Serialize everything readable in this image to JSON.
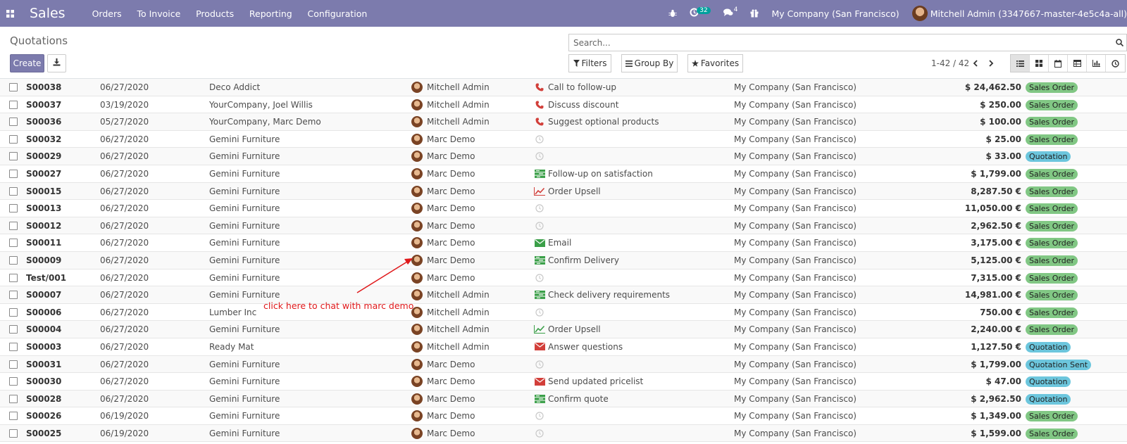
{
  "navbar": {
    "brand": "Sales",
    "menu": [
      "Orders",
      "To Invoice",
      "Products",
      "Reporting",
      "Configuration"
    ],
    "activity_count": "32",
    "message_count": "4",
    "company": "My Company (San Francisco)",
    "user": "Mitchell Admin (3347667-master-4e5c4a-all)"
  },
  "control_panel": {
    "title": "Quotations",
    "create_label": "Create",
    "search_placeholder": "Search...",
    "filters_label": "Filters",
    "groupby_label": "Group By",
    "favorites_label": "Favorites",
    "pager": "1-42 / 42"
  },
  "annotation": "click here to chat with marc demo",
  "colors": {
    "navbar": "#7c7bad",
    "sales_order": "#81c784",
    "quotation": "#6cc6dd",
    "annotation": "#e0191b"
  },
  "rows": [
    {
      "num": "S00038",
      "date": "06/27/2020",
      "customer": "Deco Addict",
      "salesperson": "Mitchell Admin",
      "activity_icon": "phone-icon",
      "activity": "Call to follow-up",
      "company": "My Company (San Francisco)",
      "total": "$ 24,462.50",
      "status": "Sales Order"
    },
    {
      "num": "S00037",
      "date": "03/19/2020",
      "customer": "YourCompany, Joel Willis",
      "salesperson": "Mitchell Admin",
      "activity_icon": "phone-icon",
      "activity": "Discuss discount",
      "company": "My Company (San Francisco)",
      "total": "$ 250.00",
      "status": "Sales Order"
    },
    {
      "num": "S00036",
      "date": "05/27/2020",
      "customer": "YourCompany, Marc Demo",
      "salesperson": "Mitchell Admin",
      "activity_icon": "phone-icon",
      "activity": "Suggest optional products",
      "company": "My Company (San Francisco)",
      "total": "$ 100.00",
      "status": "Sales Order"
    },
    {
      "num": "S00032",
      "date": "06/27/2020",
      "customer": "Gemini Furniture",
      "salesperson": "Marc Demo",
      "activity_icon": "clock-icon",
      "activity": "",
      "company": "My Company (San Francisco)",
      "total": "$ 25.00",
      "status": "Sales Order"
    },
    {
      "num": "S00029",
      "date": "06/27/2020",
      "customer": "Gemini Furniture",
      "salesperson": "Marc Demo",
      "activity_icon": "clock-icon",
      "activity": "",
      "company": "My Company (San Francisco)",
      "total": "$ 33.00",
      "status": "Quotation"
    },
    {
      "num": "S00027",
      "date": "06/27/2020",
      "customer": "Gemini Furniture",
      "salesperson": "Marc Demo",
      "activity_icon": "tasks-icon",
      "activity": "Follow-up on satisfaction",
      "company": "My Company (San Francisco)",
      "total": "$ 1,799.00",
      "status": "Sales Order"
    },
    {
      "num": "S00015",
      "date": "06/27/2020",
      "customer": "Gemini Furniture",
      "salesperson": "Marc Demo",
      "activity_icon": "chart-line-icon-red",
      "activity": "Order Upsell",
      "company": "My Company (San Francisco)",
      "total": "8,287.50 €",
      "status": "Sales Order"
    },
    {
      "num": "S00013",
      "date": "06/27/2020",
      "customer": "Gemini Furniture",
      "salesperson": "Marc Demo",
      "activity_icon": "clock-icon",
      "activity": "",
      "company": "My Company (San Francisco)",
      "total": "11,050.00 €",
      "status": "Sales Order"
    },
    {
      "num": "S00012",
      "date": "06/27/2020",
      "customer": "Gemini Furniture",
      "salesperson": "Marc Demo",
      "activity_icon": "clock-icon",
      "activity": "",
      "company": "My Company (San Francisco)",
      "total": "2,962.50 €",
      "status": "Sales Order"
    },
    {
      "num": "S00011",
      "date": "06/27/2020",
      "customer": "Gemini Furniture",
      "salesperson": "Marc Demo",
      "activity_icon": "envelope-icon-green",
      "activity": "Email",
      "company": "My Company (San Francisco)",
      "total": "3,175.00 €",
      "status": "Sales Order"
    },
    {
      "num": "S00009",
      "date": "06/27/2020",
      "customer": "Gemini Furniture",
      "salesperson": "Marc Demo",
      "activity_icon": "tasks-icon",
      "activity": "Confirm Delivery",
      "company": "My Company (San Francisco)",
      "total": "5,125.00 €",
      "status": "Sales Order"
    },
    {
      "num": "Test/001",
      "date": "06/27/2020",
      "customer": "Gemini Furniture",
      "salesperson": "Marc Demo",
      "activity_icon": "clock-icon",
      "activity": "",
      "company": "My Company (San Francisco)",
      "total": "7,315.00 €",
      "status": "Sales Order"
    },
    {
      "num": "S00007",
      "date": "06/27/2020",
      "customer": "Gemini Furniture",
      "salesperson": "Mitchell Admin",
      "activity_icon": "tasks-icon",
      "activity": "Check delivery requirements",
      "company": "My Company (San Francisco)",
      "total": "14,981.00 €",
      "status": "Sales Order"
    },
    {
      "num": "S00006",
      "date": "06/27/2020",
      "customer": "Lumber Inc",
      "salesperson": "Mitchell Admin",
      "activity_icon": "clock-icon",
      "activity": "",
      "company": "My Company (San Francisco)",
      "total": "750.00 €",
      "status": "Sales Order"
    },
    {
      "num": "S00004",
      "date": "06/27/2020",
      "customer": "Gemini Furniture",
      "salesperson": "Mitchell Admin",
      "activity_icon": "chart-line-icon-green",
      "activity": "Order Upsell",
      "company": "My Company (San Francisco)",
      "total": "2,240.00 €",
      "status": "Sales Order"
    },
    {
      "num": "S00003",
      "date": "06/27/2020",
      "customer": "Ready Mat",
      "salesperson": "Mitchell Admin",
      "activity_icon": "envelope-icon-red",
      "activity": "Answer questions",
      "company": "My Company (San Francisco)",
      "total": "1,127.50 €",
      "status": "Quotation"
    },
    {
      "num": "S00031",
      "date": "06/27/2020",
      "customer": "Gemini Furniture",
      "salesperson": "Marc Demo",
      "activity_icon": "clock-icon",
      "activity": "",
      "company": "My Company (San Francisco)",
      "total": "$ 1,799.00",
      "status": "Quotation Sent"
    },
    {
      "num": "S00030",
      "date": "06/27/2020",
      "customer": "Gemini Furniture",
      "salesperson": "Marc Demo",
      "activity_icon": "envelope-icon-red",
      "activity": "Send updated pricelist",
      "company": "My Company (San Francisco)",
      "total": "$ 47.00",
      "status": "Quotation"
    },
    {
      "num": "S00028",
      "date": "06/27/2020",
      "customer": "Gemini Furniture",
      "salesperson": "Marc Demo",
      "activity_icon": "tasks-icon",
      "activity": "Confirm quote",
      "company": "My Company (San Francisco)",
      "total": "$ 2,962.50",
      "status": "Quotation"
    },
    {
      "num": "S00026",
      "date": "06/19/2020",
      "customer": "Gemini Furniture",
      "salesperson": "Marc Demo",
      "activity_icon": "clock-icon",
      "activity": "",
      "company": "My Company (San Francisco)",
      "total": "$ 1,349.00",
      "status": "Sales Order"
    },
    {
      "num": "S00025",
      "date": "06/19/2020",
      "customer": "Gemini Furniture",
      "salesperson": "Marc Demo",
      "activity_icon": "clock-icon",
      "activity": "",
      "company": "My Company (San Francisco)",
      "total": "$ 1,599.00",
      "status": "Sales Order"
    }
  ]
}
